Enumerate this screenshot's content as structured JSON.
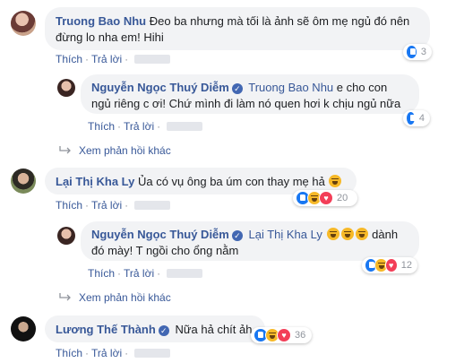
{
  "comments": [
    {
      "author": "Truong Bao Nhu",
      "text": "Đeo ba nhưng mà tối là ảnh sẽ ôm mẹ ngủ đó nên đừng lo nha em! Hihi",
      "like_label": "Thích",
      "reply_label": "Trả lời",
      "reaction_count": "3",
      "reply": {
        "author": "Nguyễn Ngọc Thuý Diễm",
        "mention": "Truong Bao Nhu",
        "text_line1": "e cho con",
        "text_line2": "ngủ riêng c ơi! Chứ mình đi làm nó quen hơi k chịu ngủ nữa",
        "like_label": "Thích",
        "reply_label": "Trả lời",
        "reaction_count": "4"
      },
      "more_replies": "Xem phản hồi khác"
    },
    {
      "author": "Lại Thị Kha Ly",
      "text": "Ủa có vụ ông ba úm con thay mẹ hả",
      "like_label": "Thích",
      "reply_label": "Trả lời",
      "reaction_count": "20",
      "reply": {
        "author": "Nguyễn Ngọc Thuý Diễm",
        "mention": "Lại Thị Kha Ly",
        "text_after": "dành",
        "text_line2": "đó mày! T ngồi cho ổng nằm",
        "like_label": "Thích",
        "reply_label": "Trả lời",
        "reaction_count": "12"
      },
      "more_replies": "Xem phản hồi khác"
    },
    {
      "author": "Lương Thế Thành",
      "text": "Nữa hả chít ảh",
      "like_label": "Thích",
      "reply_label": "Trả lời",
      "reaction_count": "36"
    }
  ],
  "colors": {
    "link": "#385898",
    "bubble": "#f2f3f5",
    "like": "#1877f2",
    "haha": "#f7b928",
    "love": "#f33e58"
  }
}
